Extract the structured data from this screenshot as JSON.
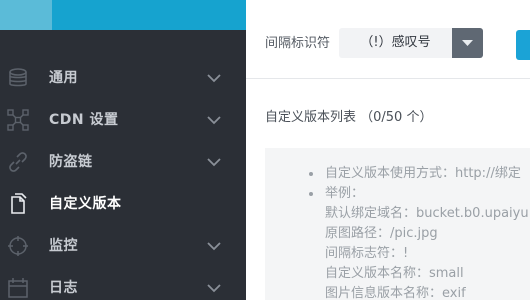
{
  "sidebar": {
    "items": [
      {
        "label": "通用",
        "icon": "database-icon"
      },
      {
        "label": "CDN 设置",
        "icon": "network-icon"
      },
      {
        "label": "防盗链",
        "icon": "link-icon"
      },
      {
        "label": "自定义版本",
        "icon": "copy-icon"
      },
      {
        "label": "监控",
        "icon": "crosshair-icon"
      },
      {
        "label": "日志",
        "icon": "calendar-icon"
      }
    ]
  },
  "main": {
    "separator_label": "间隔标识符",
    "separator_value": "（!）感叹号",
    "list_title": "自定义版本列表 （0/50 个）",
    "info": {
      "usage": "自定义版本使用方式：http://绑定",
      "example_label": "举例：",
      "lines": [
        "默认绑定域名：bucket.b0.upaiyu",
        "原图路径：/pic.jpg",
        "间隔标志符：!",
        "自定义版本名称：small",
        "图片信息版本名称：exif"
      ]
    }
  },
  "colors": {
    "sidebar_bg": "#2b2f36",
    "brand_light": "#5bbbd8",
    "brand_blue": "#16a3cf",
    "button_blue": "#1ba3d6",
    "dropdown_dark": "#5f6873"
  }
}
